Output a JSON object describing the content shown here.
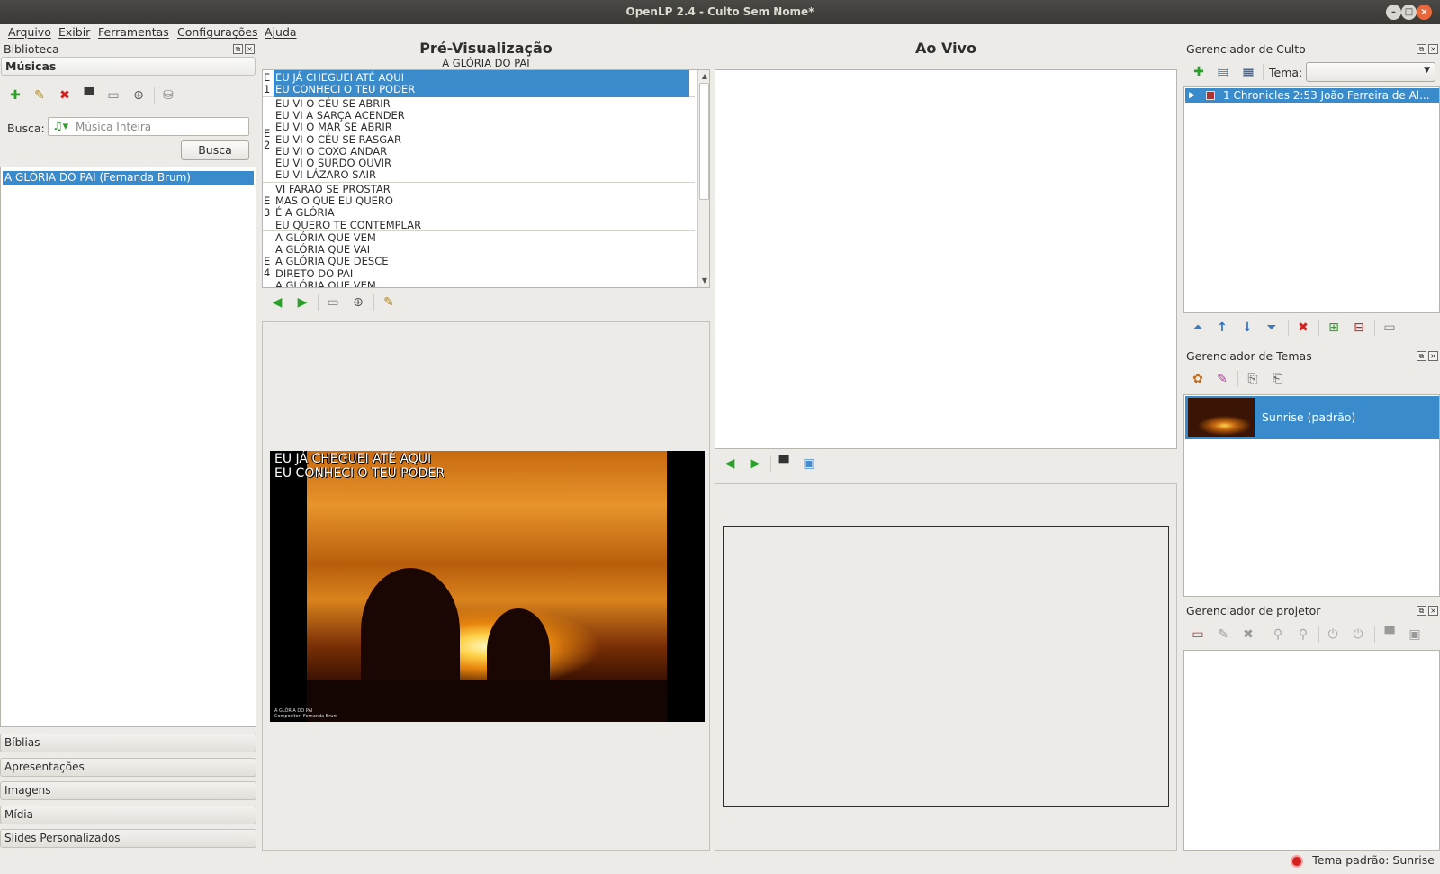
{
  "window": {
    "title": "OpenLP 2.4 - Culto Sem Nome*"
  },
  "menu": [
    "Arquivo",
    "Exibir",
    "Ferramentas",
    "Configurações",
    "Ajuda"
  ],
  "library": {
    "title": "Biblioteca",
    "section": "Músicas",
    "search_label": "Busca:",
    "search_placeholder": "Música Inteira",
    "search_button": "Busca",
    "results": [
      "A GLÓRIA DO PAI (Fernanda Brum)"
    ],
    "accordion": [
      "Bíblias",
      "Apresentações",
      "Imagens",
      "Mídia",
      "Slides Personalizados"
    ]
  },
  "preview": {
    "title": "Pré-Visualização",
    "song_title": "A GLÓRIA DO PAI",
    "slides": [
      {
        "tag": "E\n1",
        "text": "EU JÁ CHEGUEI ATÉ AQUI\nEU CONHECI O TEU PODER",
        "selected": true
      },
      {
        "tag": "E\n2",
        "text": "EU VI O CÉU SE ABRIR\nEU VI A SARÇA ACENDER\nEU VI O MAR SE ABRIR\nEU VI O CÉU SE RASGAR\nEU VI O COXO ANDAR\nEU VI O SURDO OUVIR\nEU VI LÁZARO SAIR",
        "selected": false
      },
      {
        "tag": "E\n3",
        "text": "VI FARAÓ SE PROSTAR\nMAS O QUE EU QUERO\nÉ A GLÓRIA\nEU QUERO TE CONTEMPLAR",
        "selected": false
      },
      {
        "tag": "E\n4",
        "text": "A GLÓRIA QUE VEM\nA GLÓRIA QUE VAI\nA GLÓRIA QUE DESCE\nDIRETO DO PAI\nA GLÓRIA QUE VEM",
        "selected": false
      }
    ],
    "screen_text": "EU JÁ CHEGUEI ATÉ AQUI\nEU CONHECI O TEU PODER",
    "footer_line1": "A GLÓRIA DO PAI",
    "footer_line2": "Compositor: Fernanda Brum"
  },
  "live": {
    "title": "Ao Vivo"
  },
  "service": {
    "title": "Gerenciador de Culto",
    "theme_label": "Tema:",
    "theme_value": "",
    "items": [
      "1 Chronicles 2:53 João Ferreira de Al..."
    ]
  },
  "themes": {
    "title": "Gerenciador de Temas",
    "items": [
      "Sunrise (padrão)"
    ]
  },
  "projector": {
    "title": "Gerenciador de projetor"
  },
  "status": {
    "text": "Tema padrão: Sunrise"
  },
  "colors": {
    "selection": "#3a8bcb",
    "accent_green": "#2aa02a",
    "danger_red": "#d42020"
  }
}
